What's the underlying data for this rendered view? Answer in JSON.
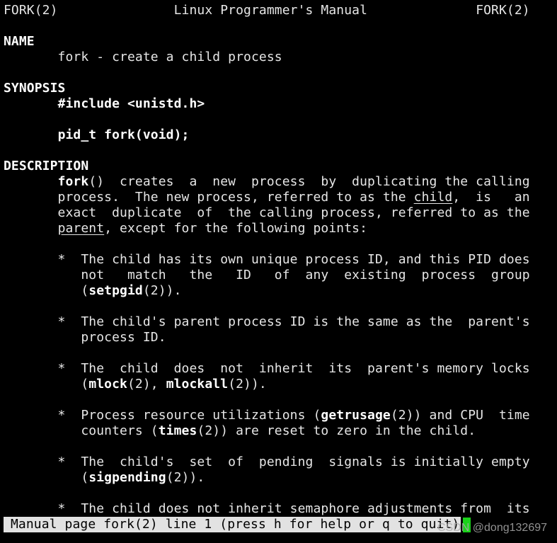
{
  "header": {
    "left": "FORK(2)",
    "center": "Linux Programmer's Manual",
    "right": "FORK(2)"
  },
  "lines": [
    [],
    [
      {
        "t": "NAME",
        "s": "b"
      }
    ],
    [
      {
        "t": "       fork - create a child process",
        "s": ""
      }
    ],
    [],
    [
      {
        "t": "SYNOPSIS",
        "s": "b"
      }
    ],
    [
      {
        "t": "       ",
        "s": ""
      },
      {
        "t": "#include <unistd.h>",
        "s": "b"
      }
    ],
    [],
    [
      {
        "t": "       ",
        "s": ""
      },
      {
        "t": "pid_t fork(void);",
        "s": "b"
      }
    ],
    [],
    [
      {
        "t": "DESCRIPTION",
        "s": "b"
      }
    ],
    [
      {
        "t": "       ",
        "s": ""
      },
      {
        "t": "fork",
        "s": "b"
      },
      {
        "t": "()  creates  a  new  process  by  duplicating the calling",
        "s": ""
      }
    ],
    [
      {
        "t": "       process.  The new process, referred to as the ",
        "s": ""
      },
      {
        "t": "child",
        "s": "u"
      },
      {
        "t": ",  is   an",
        "s": ""
      }
    ],
    [
      {
        "t": "       exact  duplicate  of  the calling process, referred to as the",
        "s": ""
      }
    ],
    [
      {
        "t": "       ",
        "s": ""
      },
      {
        "t": "parent",
        "s": "u"
      },
      {
        "t": ", except for the following points:",
        "s": ""
      }
    ],
    [],
    [
      {
        "t": "       *  The child has its own unique process ID, and this PID does",
        "s": ""
      }
    ],
    [
      {
        "t": "          not   match   the   ID   of  any  existing  process  group",
        "s": ""
      }
    ],
    [
      {
        "t": "          (",
        "s": ""
      },
      {
        "t": "setpgid",
        "s": "b"
      },
      {
        "t": "(2)).",
        "s": ""
      }
    ],
    [],
    [
      {
        "t": "       *  The child's parent process ID is the same as the  parent's",
        "s": ""
      }
    ],
    [
      {
        "t": "          process ID.",
        "s": ""
      }
    ],
    [],
    [
      {
        "t": "       *  The  child  does  not  inherit  its  parent's memory locks",
        "s": ""
      }
    ],
    [
      {
        "t": "          (",
        "s": ""
      },
      {
        "t": "mlock",
        "s": "b"
      },
      {
        "t": "(2), ",
        "s": ""
      },
      {
        "t": "mlockall",
        "s": "b"
      },
      {
        "t": "(2)).",
        "s": ""
      }
    ],
    [],
    [
      {
        "t": "       *  Process resource utilizations (",
        "s": ""
      },
      {
        "t": "getrusage",
        "s": "b"
      },
      {
        "t": "(2)) and CPU  time",
        "s": ""
      }
    ],
    [
      {
        "t": "          counters (",
        "s": ""
      },
      {
        "t": "times",
        "s": "b"
      },
      {
        "t": "(2)) are reset to zero in the child.",
        "s": ""
      }
    ],
    [],
    [
      {
        "t": "       *  The  child's  set  of  pending  signals is initially empty",
        "s": ""
      }
    ],
    [
      {
        "t": "          (",
        "s": ""
      },
      {
        "t": "sigpending",
        "s": "b"
      },
      {
        "t": "(2)).",
        "s": ""
      }
    ],
    [],
    [
      {
        "t": "       *  The child does not inherit semaphore adjustments from  its",
        "s": ""
      }
    ]
  ],
  "status_bar": {
    "text": "Manual page fork(2) line 1 (press h for help or q to quit)"
  },
  "watermark": "CSDN @dong132697",
  "colors": {
    "background": "#000000",
    "status_bg": "#e2e2e2",
    "cursor": "#1bd21b"
  }
}
